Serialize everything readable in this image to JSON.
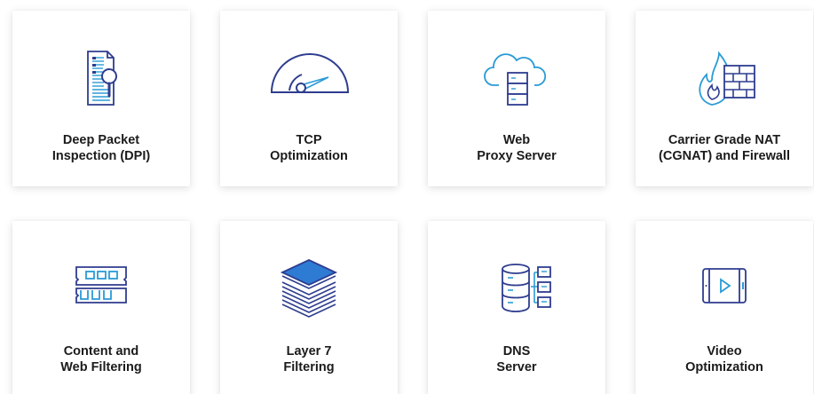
{
  "theme": {
    "icon_stroke": "#2e3d8f",
    "icon_accent": "#2a9bd6",
    "icon_fill": "#2e7bd4",
    "label_color": "#1b1b1b",
    "card_background": "#ffffff"
  },
  "cards": [
    {
      "icon": "document-magnifier-icon",
      "lines": [
        "Deep Packet",
        "Inspection (DPI)"
      ]
    },
    {
      "icon": "speed-gauge-icon",
      "lines": [
        "TCP",
        "Optimization"
      ]
    },
    {
      "icon": "cloud-server-icon",
      "lines": [
        "Web",
        "Proxy Server"
      ]
    },
    {
      "icon": "fire-wall-icon",
      "lines": [
        "Carrier Grade NAT",
        "(CGNAT) and Firewall"
      ]
    },
    {
      "icon": "filter-card-icon",
      "lines": [
        "Content and",
        "Web Filtering"
      ]
    },
    {
      "icon": "layers-stack-icon",
      "lines": [
        "Layer 7",
        "Filtering"
      ]
    },
    {
      "icon": "database-tree-icon",
      "lines": [
        "DNS",
        "Server"
      ]
    },
    {
      "icon": "video-player-icon",
      "lines": [
        "Video",
        "Optimization"
      ]
    }
  ]
}
